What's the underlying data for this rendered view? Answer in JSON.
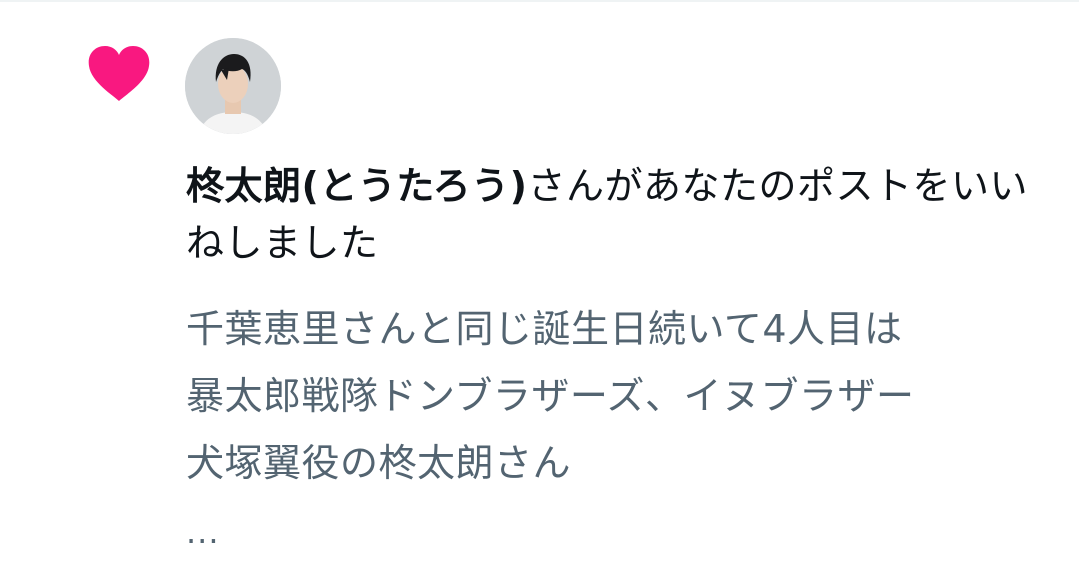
{
  "notification": {
    "icon": "heart-icon",
    "icon_color": "#f91880",
    "user_name": "柊太朗(とうたろう)",
    "action_text": "さんがあなたのポストをいいねしました"
  },
  "post_preview": {
    "lines": [
      "千葉恵里さんと同じ誕生日続いて4人目は",
      "暴太郎戦隊ドンブラザーズ、イヌブラザー",
      "犬塚翼役の柊太朗さん"
    ],
    "truncation": "..."
  },
  "colors": {
    "primary_text": "#0f1419",
    "secondary_text": "#536471",
    "like_pink": "#f91880"
  }
}
